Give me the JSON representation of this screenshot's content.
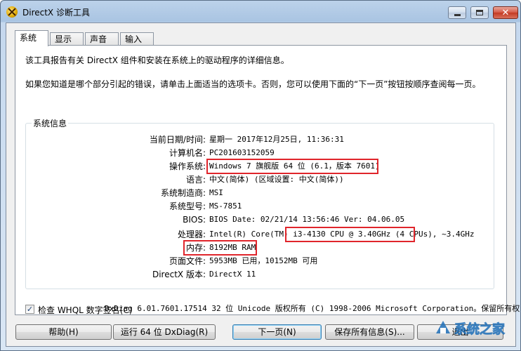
{
  "window": {
    "title": "DirectX 诊断工具"
  },
  "tabs": [
    {
      "label": "系统",
      "active": true
    },
    {
      "label": "显示",
      "active": false
    },
    {
      "label": "声音",
      "active": false
    },
    {
      "label": "输入",
      "active": false
    }
  ],
  "intro": {
    "line1": "该工具报告有关 DirectX 组件和安装在系统上的驱动程序的详细信息。",
    "line2": "如果您知道是哪个部分引起的错误，请单击上面适当的选项卡。否则，您可以使用下面的“下一页”按钮按顺序查阅每一页。"
  },
  "system_info": {
    "group_label": "系统信息",
    "rows": [
      {
        "label": "当前日期/时间:",
        "value": "星期一 2017年12月25日, 11:36:31"
      },
      {
        "label": "计算机名:",
        "value": "PC201603152059"
      },
      {
        "label": "操作系统:",
        "value": "Windows 7 旗舰版 64 位 (6.1，版本 7601)"
      },
      {
        "label": "语言:",
        "value": "中文(简体) (区域设置: 中文(简体))"
      },
      {
        "label": "系统制造商:",
        "value": "MSI"
      },
      {
        "label": "系统型号:",
        "value": "MS-7851"
      },
      {
        "label": "BIOS:",
        "value": "BIOS Date: 02/21/14 13:56:46 Ver: 04.06.05"
      },
      {
        "label": "处理器:",
        "value": "Intel(R) Core(TM) i3-4130 CPU @ 3.40GHz (4 CPUs), ~3.4GHz"
      },
      {
        "label": "内存:",
        "value": "8192MB RAM"
      },
      {
        "label": "页面文件:",
        "value": "5953MB 已用，10152MB 可用"
      },
      {
        "label": "DirectX 版本:",
        "value": "DirectX 11"
      }
    ]
  },
  "whql_checkbox": {
    "label": "检查 WHQL 数字签名(C)",
    "checked": true
  },
  "copyright": "DxDiag 6.01.7601.17514 32 位 Unicode 版权所有 (C) 1998-2006 Microsoft Corporation。保留所有权",
  "buttons": {
    "help": "帮助(H)",
    "run64": "运行 64 位 DxDiag(R)",
    "next": "下一页(N)",
    "save": "保存所有信息(S)...",
    "exit": "退出"
  },
  "watermark": {
    "text": "系统之家"
  },
  "colors": {
    "highlight": "#e0252b",
    "accent": "#3c7fb1"
  },
  "icons": {
    "app": "directx-icon",
    "checkbox": "check-icon"
  }
}
